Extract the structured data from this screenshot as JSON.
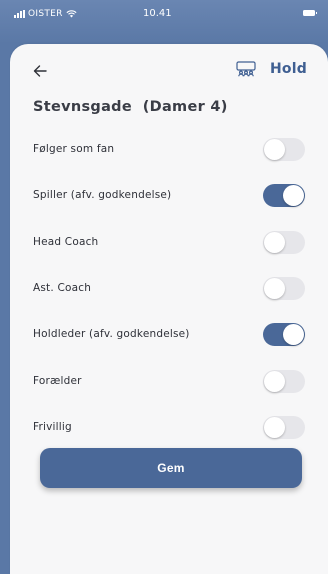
{
  "status_bar": {
    "carrier": "OISTER",
    "time": "10.41",
    "signal_icon": "signal-bars-icon",
    "wifi_icon": "wifi-icon",
    "battery_icon": "battery-icon"
  },
  "header": {
    "back_icon": "arrow-left-icon",
    "team_icon": "team-people-icon",
    "link_label": "Hold"
  },
  "team_title": "Stevnsgade  (Damer 4)",
  "roles": [
    {
      "label": "Følger som fan",
      "enabled": false
    },
    {
      "label": "Spiller (afv. godkendelse)",
      "enabled": true
    },
    {
      "label": "Head Coach",
      "enabled": false
    },
    {
      "label": "Ast. Coach",
      "enabled": false
    },
    {
      "label": "Holdleder (afv. godkendelse)",
      "enabled": true
    },
    {
      "label": "Forælder",
      "enabled": false
    },
    {
      "label": "Frivillig",
      "enabled": false
    }
  ],
  "save_label": "Gem",
  "colors": {
    "accent": "#4a6898",
    "header_bg": "#5a78a6",
    "toggle_off": "#e6e6ea",
    "sheet_bg": "#f7f7f8"
  }
}
